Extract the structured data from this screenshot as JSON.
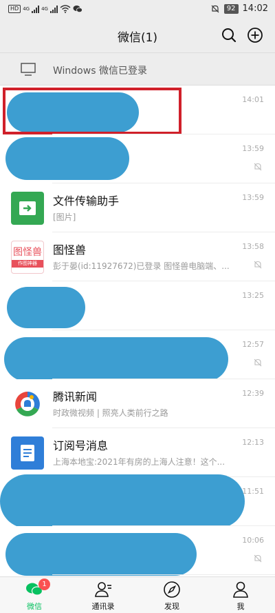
{
  "status_bar": {
    "left_chip": "HD",
    "network_a": "4G",
    "network_b": "4G",
    "battery": "92",
    "time": "14:02"
  },
  "header": {
    "title": "微信(1)",
    "search_icon": "search-icon",
    "add_icon": "plus-circle-icon"
  },
  "banner": {
    "text": "Windows 微信已登录",
    "icon": "monitor-icon"
  },
  "chats": [
    {
      "name": "",
      "preview": "",
      "time": "14:01",
      "muted": false,
      "redacted": true
    },
    {
      "name": "",
      "preview": "",
      "time": "13:59",
      "muted": true,
      "redacted": true
    },
    {
      "name": "文件传输助手",
      "preview": "[图片]",
      "time": "13:59",
      "muted": false,
      "avatar": "file-transfer-icon",
      "avatar_color": "#34a853"
    },
    {
      "name": "图怪兽",
      "preview": "彭于晏(id:11927672)已登录 图怪兽电脑端、...",
      "time": "13:58",
      "muted": true,
      "avatar": "tuguaishou-logo",
      "avatar_title": "图怪兽",
      "avatar_subtitle": "作图神器",
      "avatar_color": "#e8505b"
    },
    {
      "name": "",
      "preview": "",
      "time": "13:25",
      "muted": false,
      "redacted": true
    },
    {
      "name": "",
      "preview": "",
      "time": "12:57",
      "muted": true,
      "redacted": true
    },
    {
      "name": "腾讯新闻",
      "preview": "时政微视频 | 照亮人类前行之路",
      "time": "12:39",
      "muted": false,
      "avatar": "tencent-news-logo"
    },
    {
      "name": "订阅号消息",
      "preview": "上海本地宝:2021年有房的上海人注意！这个...",
      "time": "12:13",
      "muted": false,
      "avatar": "subscription-icon",
      "avatar_color": "#2f7ed8"
    },
    {
      "name": "",
      "preview": "",
      "time": "11:51",
      "muted": false,
      "redacted": true
    },
    {
      "name": "",
      "preview": "",
      "time": "10:06",
      "muted": true,
      "redacted": true
    }
  ],
  "tabs": [
    {
      "label": "微信",
      "icon": "chat-bubble-icon",
      "badge": "1",
      "active": true
    },
    {
      "label": "通讯录",
      "icon": "contacts-icon",
      "active": false
    },
    {
      "label": "发现",
      "icon": "compass-icon",
      "active": false
    },
    {
      "label": "我",
      "icon": "person-icon",
      "active": false
    }
  ],
  "colors": {
    "accent_green": "#07c160",
    "redaction_blue": "#3d9ed1",
    "highlight_red": "#d0202a",
    "badge_red": "#fa5151"
  }
}
